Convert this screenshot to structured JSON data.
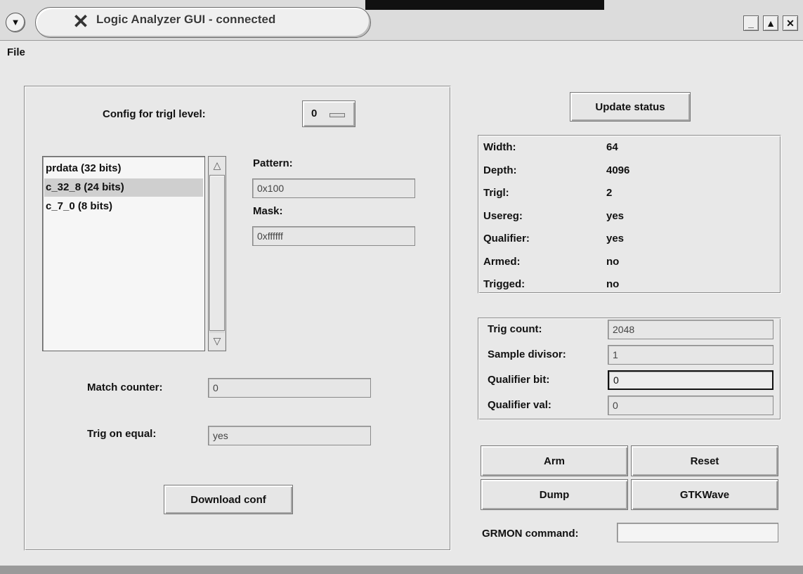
{
  "window": {
    "title": "Logic Analyzer GUI - connected",
    "controls": [
      "minimize-icon",
      "maximize-icon",
      "close-icon"
    ]
  },
  "menubar": {
    "file": "File"
  },
  "config": {
    "trig_level_label": "Config for trigl level:",
    "trig_level_value": "0",
    "signals": [
      "prdata (32 bits)",
      "c_32_8 (24 bits)",
      "c_7_0 (8 bits)"
    ],
    "selected_index": 1,
    "pattern_label": "Pattern:",
    "pattern_value": "0x100",
    "mask_label": "Mask:",
    "mask_value": "0xffffff",
    "match_counter_label": "Match counter:",
    "match_counter_value": "0",
    "trig_on_equal_label": "Trig on equal:",
    "trig_on_equal_value": "yes",
    "download_button": "Download conf"
  },
  "status": {
    "update_button": "Update status",
    "rows": [
      {
        "label": "Width:",
        "value": "64"
      },
      {
        "label": "Depth:",
        "value": "4096"
      },
      {
        "label": "Trigl:",
        "value": "2"
      },
      {
        "label": "Usereg:",
        "value": "yes"
      },
      {
        "label": "Qualifier:",
        "value": "yes"
      },
      {
        "label": "Armed:",
        "value": "no"
      },
      {
        "label": "Trigged:",
        "value": "no"
      }
    ]
  },
  "settings": {
    "rows": [
      {
        "label": "Trig count:",
        "value": "2048"
      },
      {
        "label": "Sample divisor:",
        "value": "1"
      },
      {
        "label": "Qualifier bit:",
        "value": "0"
      },
      {
        "label": "Qualifier val:",
        "value": "0"
      }
    ],
    "active_index": 2
  },
  "actions": {
    "arm": "Arm",
    "reset": "Reset",
    "dump": "Dump",
    "gtkwave": "GTKWave",
    "grmon_label": "GRMON command:",
    "grmon_value": ""
  }
}
